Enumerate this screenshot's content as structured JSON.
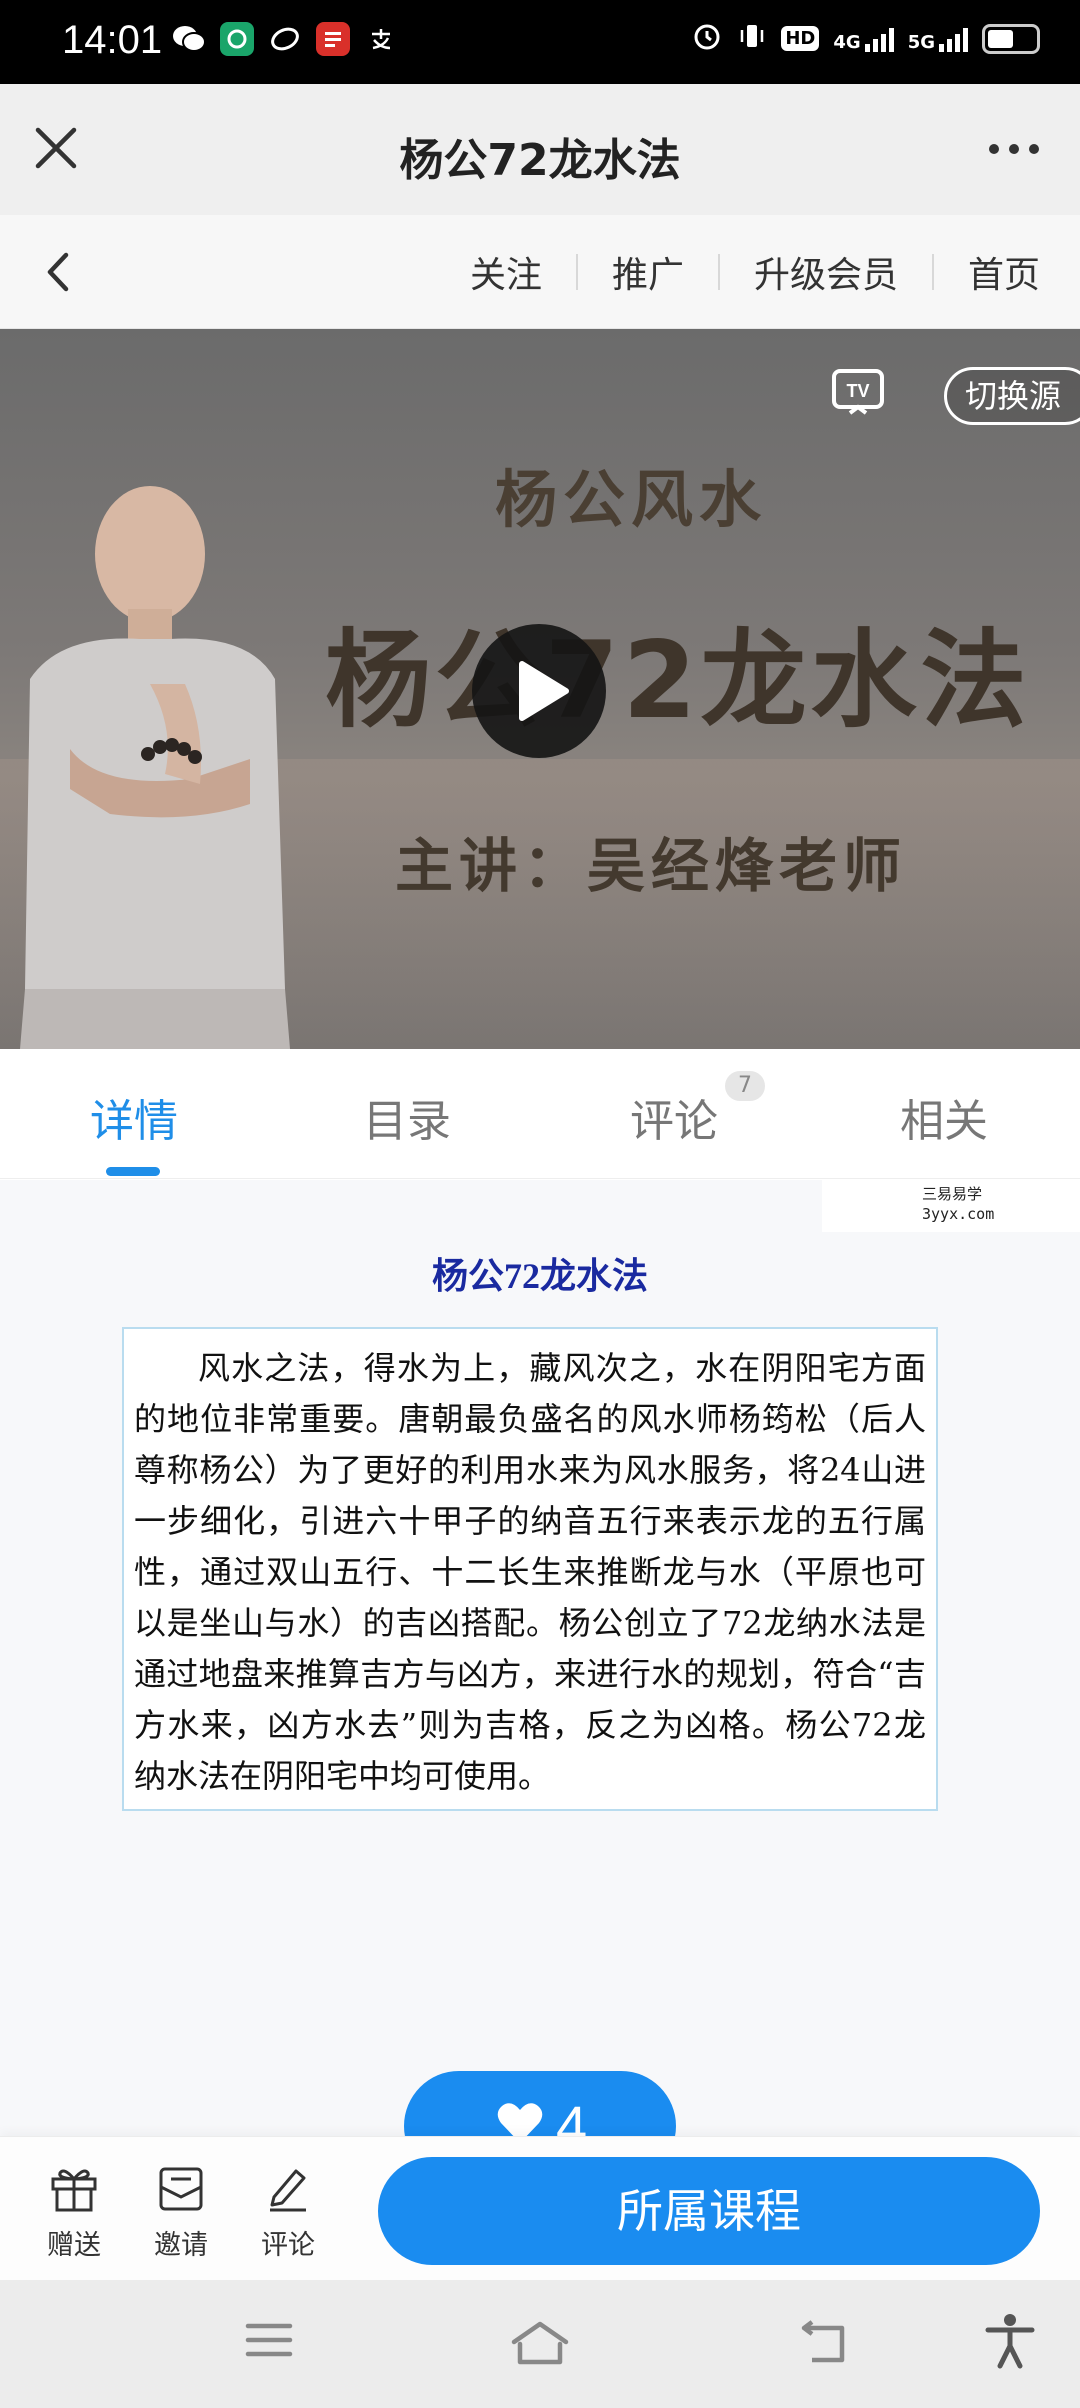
{
  "status_bar": {
    "time": "14:01",
    "network_1": "4G",
    "network_2": "5G",
    "hd_label": "HD",
    "battery_level": 0.55
  },
  "title_bar": {
    "title": "杨公72龙水法",
    "close_icon": "close-icon",
    "more_icon": "more-dots-icon"
  },
  "nav": {
    "back_icon": "chevron-left-icon",
    "links": [
      "关注",
      "推广",
      "升级会员",
      "首页"
    ]
  },
  "video": {
    "line1": "杨公风水",
    "line2": "杨公72龙水法",
    "line3": "主讲：吴经烽老师",
    "switch_source": "切换源",
    "tv_icon_label": "TV"
  },
  "tabs": {
    "items": [
      "详情",
      "目录",
      "评论",
      "相关"
    ],
    "active_index": 0,
    "comment_badge": "7"
  },
  "watermark": {
    "line1": "三易易学",
    "line2": "3yyx.com"
  },
  "article": {
    "title": "杨公72龙水法",
    "body": "风水之法，得水为上，藏风次之，水在阴阳宅方面的地位非常重要。唐朝最负盛名的风水师杨筠松（后人尊称杨公）为了更好的利用水来为风水服务，将24山进一步细化，引进六十甲子的纳音五行来表示龙的五行属性，通过双山五行、十二长生来推断龙与水（平原也可以是坐山与水）的吉凶搭配。杨公创立了72龙纳水法是通过地盘来推算吉方与凶方，来进行水的规划，符合“吉方水来，凶方水去”则为吉格，反之为凶格。杨公72龙纳水法在阴阳宅中均可使用。"
  },
  "like": {
    "count": "4"
  },
  "toolbar": {
    "gift_label": "赠送",
    "invite_label": "邀请",
    "comment_label": "评论",
    "course_button": "所属课程"
  },
  "colors": {
    "accent": "#1a8cf0",
    "title_blue": "#1a2aa0"
  }
}
